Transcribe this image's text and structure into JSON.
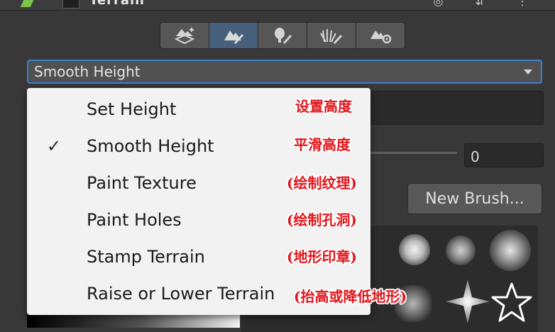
{
  "header": {
    "title": "Terrain"
  },
  "toolbar": {
    "tools": [
      {
        "icon": "create-neighbor-terrain-icon"
      },
      {
        "icon": "paint-terrain-icon",
        "selected": true
      },
      {
        "icon": "paint-trees-icon"
      },
      {
        "icon": "paint-details-icon"
      },
      {
        "icon": "terrain-settings-icon"
      }
    ]
  },
  "dropdown": {
    "selected": "Smooth Height"
  },
  "menu": {
    "items": [
      {
        "label": "Set Height",
        "checked": false,
        "check": "",
        "note": "设置高度"
      },
      {
        "label": "Smooth Height",
        "checked": true,
        "check": "✓",
        "note": "平滑高度"
      },
      {
        "label": "Paint Texture",
        "checked": false,
        "check": "",
        "note": "(绘制纹理)"
      },
      {
        "label": "Paint Holes",
        "checked": false,
        "check": "",
        "note": "(绘制孔洞)"
      },
      {
        "label": "Stamp Terrain",
        "checked": false,
        "check": "",
        "note": "(地形印章)"
      },
      {
        "label": "Raise or Lower Terrain",
        "checked": false,
        "check": "",
        "note": "(抬高或降低地形)"
      }
    ]
  },
  "controls": {
    "number_value": "0",
    "new_brush_label": "New Brush..."
  },
  "colors": {
    "accent": "#3b7fd0",
    "selected_tool": "#46607c",
    "annotation": "#e0151b"
  }
}
